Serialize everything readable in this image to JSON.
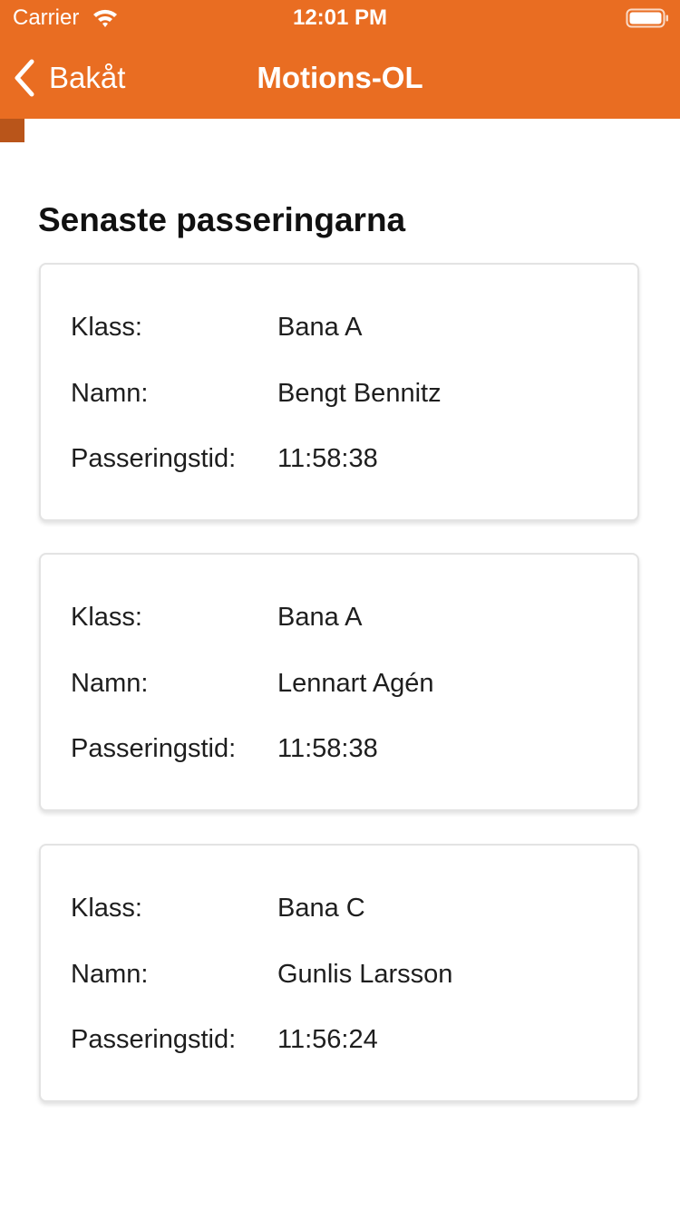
{
  "status_bar": {
    "carrier": "Carrier",
    "time": "12:01 PM",
    "wifi_icon": "wifi-icon",
    "battery_icon": "battery-icon"
  },
  "nav": {
    "back_label": "Bakåt",
    "back_icon": "chevron-left-icon",
    "title": "Motions-OL"
  },
  "colors": {
    "header_bg": "#E96D22",
    "accent_tab": "#B9551A",
    "text": "#1E1E1E"
  },
  "section_title": "Senaste passeringarna",
  "passings": [
    {
      "klass_label": "Klass:",
      "klass": "Bana A",
      "namn_label": "Namn:",
      "namn": "Bengt Bennitz",
      "tid_label": "Passeringstid:",
      "tid": "11:58:38"
    },
    {
      "klass_label": "Klass:",
      "klass": "Bana A",
      "namn_label": "Namn:",
      "namn": "Lennart Agén",
      "tid_label": "Passeringstid:",
      "tid": "11:58:38"
    },
    {
      "klass_label": "Klass:",
      "klass": "Bana C",
      "namn_label": "Namn:",
      "namn": "Gunlis Larsson",
      "tid_label": "Passeringstid:",
      "tid": "11:56:24"
    }
  ]
}
